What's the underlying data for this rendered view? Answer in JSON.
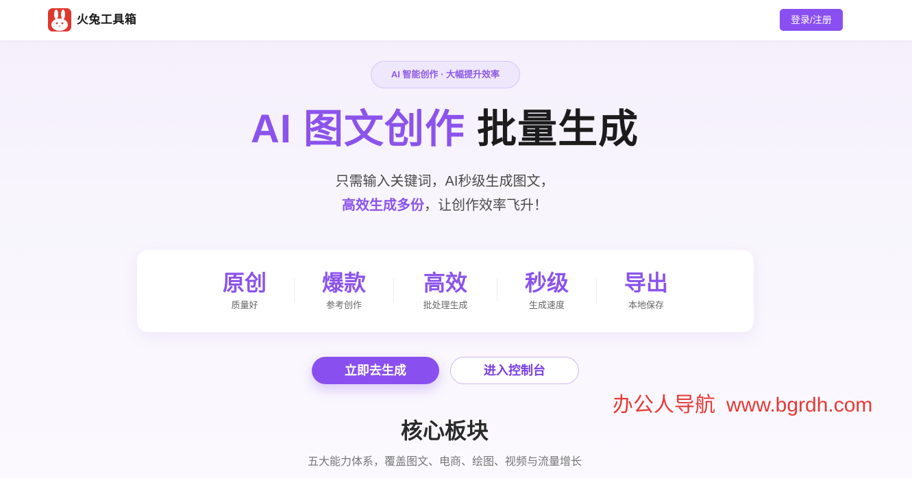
{
  "header": {
    "brand": "火兔工具箱",
    "login_label": "登录/注册",
    "colors": {
      "accent": "#8a4ff0",
      "logo_bg": "#e0372d"
    }
  },
  "hero": {
    "pill": "AI 智能创作 · 大幅提升效率",
    "title_accent": "AI 图文创作",
    "title_rest": "批量生成",
    "subtitle_line1": "只需输入关键词，AI秒级生成图文，",
    "subtitle_line2_highlight": "高效生成多份",
    "subtitle_line2_rest": "，让创作效率飞升！"
  },
  "features": [
    {
      "title": "原创",
      "sub": "质量好"
    },
    {
      "title": "爆款",
      "sub": "参考创作"
    },
    {
      "title": "高效",
      "sub": "批处理生成"
    },
    {
      "title": "秒级",
      "sub": "生成速度"
    },
    {
      "title": "导出",
      "sub": "本地保存"
    }
  ],
  "cta": {
    "primary": "立即去生成",
    "secondary": "进入控制台"
  },
  "watermark": {
    "name": "办公人导航",
    "url": "www.bgrdh.com"
  },
  "section": {
    "title": "核心板块",
    "subtitle": "五大能力体系，覆盖图文、电商、绘图、视频与流量增长"
  }
}
